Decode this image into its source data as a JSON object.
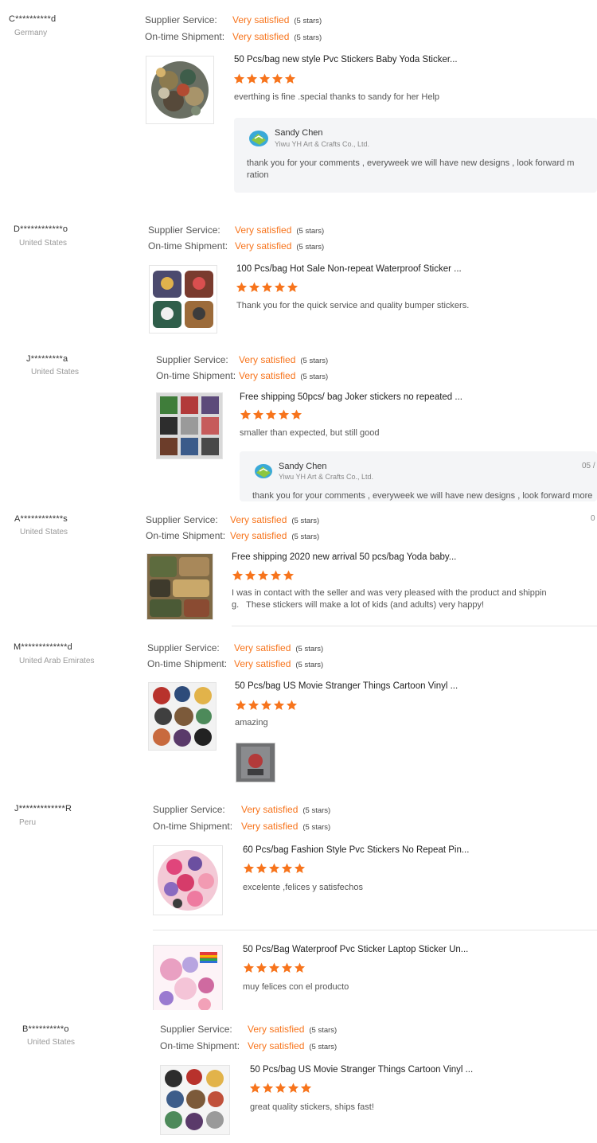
{
  "labels": {
    "supplier_service": "Supplier Service:",
    "on_time_shipment": "On-time Shipment:",
    "very_satisfied": "Very satisfied",
    "five_stars": "(5 stars)"
  },
  "colors": {
    "accent": "#f7741c",
    "star": "#f7741c",
    "reply_bg": "#f4f5f7"
  },
  "reviews": [
    {
      "buyer": "C**********d",
      "country": "Germany",
      "product": "50 Pcs/bag new style Pvc Stickers Baby Yoda Sticker...",
      "rating": 5,
      "comment": "everthing is fine .special thanks to sandy for her Help",
      "reply": {
        "name": "Sandy Chen",
        "company": "Yiwu YH Art & Crafts Co., Ltd.",
        "text_line1": "thank you for your comments , everyweek we will have new designs , look forward m",
        "text_line2": "ration"
      }
    },
    {
      "buyer": "D************o",
      "country": "United States",
      "product": "100 Pcs/bag Hot Sale Non-repeat Waterproof Sticker ...",
      "rating": 5,
      "comment": "Thank you for the quick service and quality bumper stickers."
    },
    {
      "buyer": "J*********a",
      "country": "United States",
      "product": "Free shipping 50pcs/ bag Joker stickers no repeated ...",
      "rating": 5,
      "comment": "smaller than expected, but still good",
      "reply": {
        "name": "Sandy Chen",
        "company": "Yiwu YH Art & Crafts Co., Ltd.",
        "text_line1": "thank you for your comments , everyweek we will have new designs , look forward more",
        "date": "05 /"
      }
    },
    {
      "buyer": "A************s",
      "country": "United States",
      "edge_fragment": "0",
      "product": "Free shipping 2020 new arrival 50 pcs/bag Yoda baby...",
      "rating": 5,
      "comment_line1": "I was in contact with the seller and was very pleased with the product and shippin",
      "comment_line2": "g.   These stickers will make a lot of kids (and adults) very happy!"
    },
    {
      "buyer": "M*************d",
      "country": "United Arab Emirates",
      "product": "50 Pcs/bag US Movie Stranger Things Cartoon Vinyl ...",
      "rating": 5,
      "comment": "amazing"
    },
    {
      "buyer": "J*************R",
      "country": "Peru",
      "items": [
        {
          "product": "60 Pcs/bag Fashion Style Pvc Stickers No Repeat Pin...",
          "rating": 5,
          "comment": "excelente ,felices y satisfechos"
        },
        {
          "product": "50 Pcs/Bag Waterproof Pvc Sticker Laptop Sticker Un...",
          "rating": 5,
          "comment": "muy felices con el producto"
        }
      ]
    },
    {
      "buyer": "B**********o",
      "country": "United States",
      "product": "50 Pcs/bag US Movie Stranger Things Cartoon Vinyl ...",
      "rating": 5,
      "comment": "great quality stickers, ships fast!"
    }
  ]
}
